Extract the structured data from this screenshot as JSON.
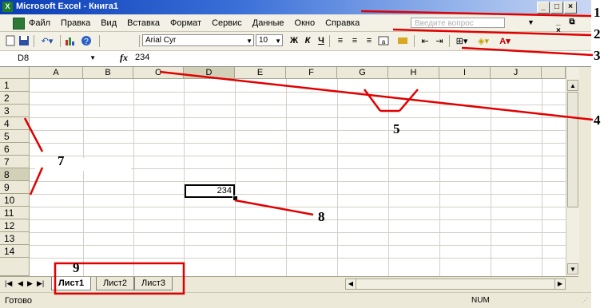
{
  "titlebar": {
    "app_icon": "X",
    "title": "Microsoft Excel - Книга1",
    "buttons": [
      "_",
      "□",
      "×"
    ]
  },
  "menubar": {
    "items": [
      "Файл",
      "Правка",
      "Вид",
      "Вставка",
      "Формат",
      "Сервис",
      "Данные",
      "Окно",
      "Справка"
    ],
    "help_placeholder": "Введите вопрос",
    "doc_controls": "_ ⧉ ×"
  },
  "toolbar": {
    "font_name": "Arial Cyr",
    "font_size": "10",
    "bold": "Ж",
    "italic": "К",
    "underline": "Ч"
  },
  "formulabar": {
    "name_box": "D8",
    "fx": "fx",
    "value": "234"
  },
  "grid": {
    "columns": [
      "A",
      "B",
      "C",
      "D",
      "E",
      "F",
      "G",
      "H",
      "I",
      "J"
    ],
    "rows": [
      "1",
      "2",
      "3",
      "4",
      "5",
      "6",
      "7",
      "8",
      "9",
      "10",
      "11",
      "12",
      "13",
      "14"
    ],
    "active_cell_value": "234"
  },
  "sheets": {
    "tabs": [
      "Лист1",
      "Лист2",
      "Лист3"
    ],
    "active": "Лист1"
  },
  "statusbar": {
    "status": "Готово",
    "num": "NUM"
  },
  "annotations": [
    "1",
    "2",
    "3",
    "4",
    "5",
    "7",
    "8",
    "9"
  ],
  "colors": {
    "title_gradient_start": "#0a3cb4",
    "excel_green": "#1d7a2e",
    "annotation_red": "#e00000"
  }
}
